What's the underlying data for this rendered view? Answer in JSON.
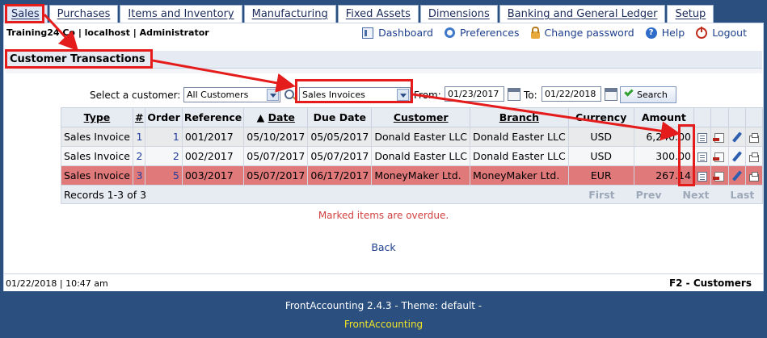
{
  "tabs": [
    "Sales",
    "Purchases",
    "Items and Inventory",
    "Manufacturing",
    "Fixed Assets",
    "Dimensions",
    "Banking and General Ledger",
    "Setup"
  ],
  "header": {
    "company": "Training24 Co | localhost | Administrator",
    "links": [
      {
        "label": "Dashboard",
        "icon": "dashboard-icon"
      },
      {
        "label": "Preferences",
        "icon": "gear-icon"
      },
      {
        "label": "Change password",
        "icon": "lock-icon"
      },
      {
        "label": "Help",
        "icon": "help-icon"
      },
      {
        "label": "Logout",
        "icon": "power-icon"
      }
    ]
  },
  "page_title": "Customer Transactions",
  "filters": {
    "customer_label": "Select a customer:",
    "customer_value": "All Customers",
    "type_value": "Sales Invoices",
    "from_label": "From:",
    "from_value": "01/23/2017",
    "to_label": "To:",
    "to_value": "01/22/2018",
    "search_label": "Search"
  },
  "table": {
    "columns": [
      "Type",
      "#",
      "Order",
      "Reference",
      "Date",
      "Due Date",
      "Customer",
      "Branch",
      "Currency",
      "Amount"
    ],
    "rows": [
      {
        "type": "Sales Invoice",
        "num": "1",
        "order": "1",
        "reference": "001/2017",
        "date": "05/10/2017",
        "due": "05/05/2017",
        "customer": "Donald Easter LLC",
        "branch": "Donald Easter LLC",
        "currency": "USD",
        "amount": "6,240.00",
        "overdue": false
      },
      {
        "type": "Sales Invoice",
        "num": "2",
        "order": "2",
        "reference": "002/2017",
        "date": "05/07/2017",
        "due": "05/07/2017",
        "customer": "Donald Easter LLC",
        "branch": "Donald Easter LLC",
        "currency": "USD",
        "amount": "300.00",
        "overdue": false
      },
      {
        "type": "Sales Invoice",
        "num": "3",
        "order": "5",
        "reference": "003/2017",
        "date": "05/07/2017",
        "due": "06/17/2017",
        "customer": "MoneyMaker Ltd.",
        "branch": "MoneyMaker Ltd.",
        "currency": "EUR",
        "amount": "267.14",
        "overdue": true
      }
    ],
    "records": "Records 1-3 of 3",
    "nav": [
      "First",
      "Prev",
      "Next",
      "Last"
    ]
  },
  "overdue_note": "Marked items are overdue.",
  "back_label": "Back",
  "status": {
    "datetime": "01/22/2018 | 10:47 am",
    "shortcut": "F2 - Customers"
  },
  "footer": {
    "version": "FrontAccounting 2.4.3 - Theme: default -",
    "link": "FrontAccounting"
  },
  "colors": {
    "background": "#2b4f7e",
    "overdue_row": "#e0797a",
    "annotation": "#e41c1c",
    "footer_link": "#f0e326"
  }
}
